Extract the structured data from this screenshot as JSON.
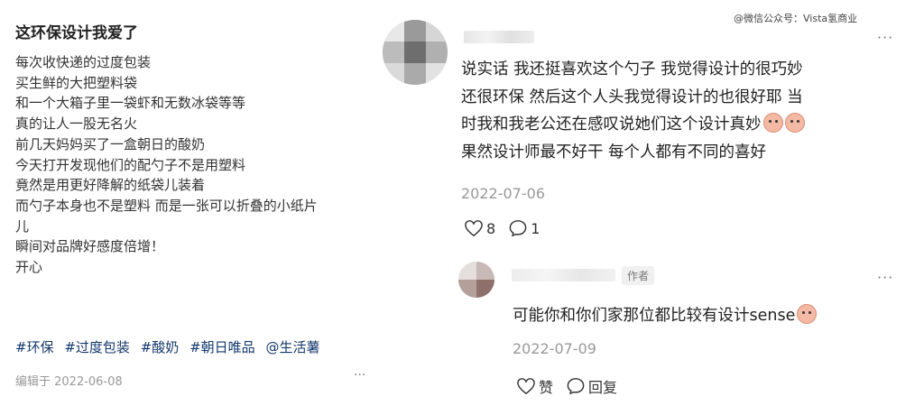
{
  "watermark": "@微信公众号：Vista氢商业",
  "post": {
    "title": "这环保设计我爱了",
    "lines": [
      "每次收快递的过度包装",
      "买生鲜的大把塑料袋",
      "和一个大箱子里一袋虾和无数冰袋等等",
      "真的让人一股无名火",
      "前几天妈妈买了一盒朝日的酸奶",
      "今天打开发现他们的配勺子不是用塑料",
      "竟然是用更好降解的纸袋儿装着",
      "而勺子本身也不是塑料 而是一张可以折叠的小纸片",
      "儿",
      "瞬间对品牌好感度倍增！",
      "开心"
    ],
    "tags": [
      "#环保",
      "#过度包装",
      "#酸奶",
      "#朝日唯品",
      "@生活薯"
    ],
    "edited": "编辑于 2022-06-08",
    "more": "···"
  },
  "comment1": {
    "lines": [
      "说实话 我还挺喜欢这个勺子 我觉得设计的很巧妙",
      "还很环保 然后这个人头我觉得设计的也很好耶 当",
      "时我和我老公还在感叹说她们这个设计真妙",
      "果然设计师最不好干 每个人都有不同的喜好"
    ],
    "emoji": "crying-face-emoji",
    "date": "2022-07-06",
    "like_count": "8",
    "reply_count": "1",
    "more": "···"
  },
  "comment2": {
    "badge": "作者",
    "text": "可能你和你们家那位都比较有设计sense",
    "emoji": "smiling-face-emoji",
    "date": "2022-07-09",
    "like_label": "赞",
    "reply_label": "回复",
    "more": "···"
  },
  "colors": {
    "tag": "#13386c",
    "date": "#999999",
    "text": "#222222"
  }
}
